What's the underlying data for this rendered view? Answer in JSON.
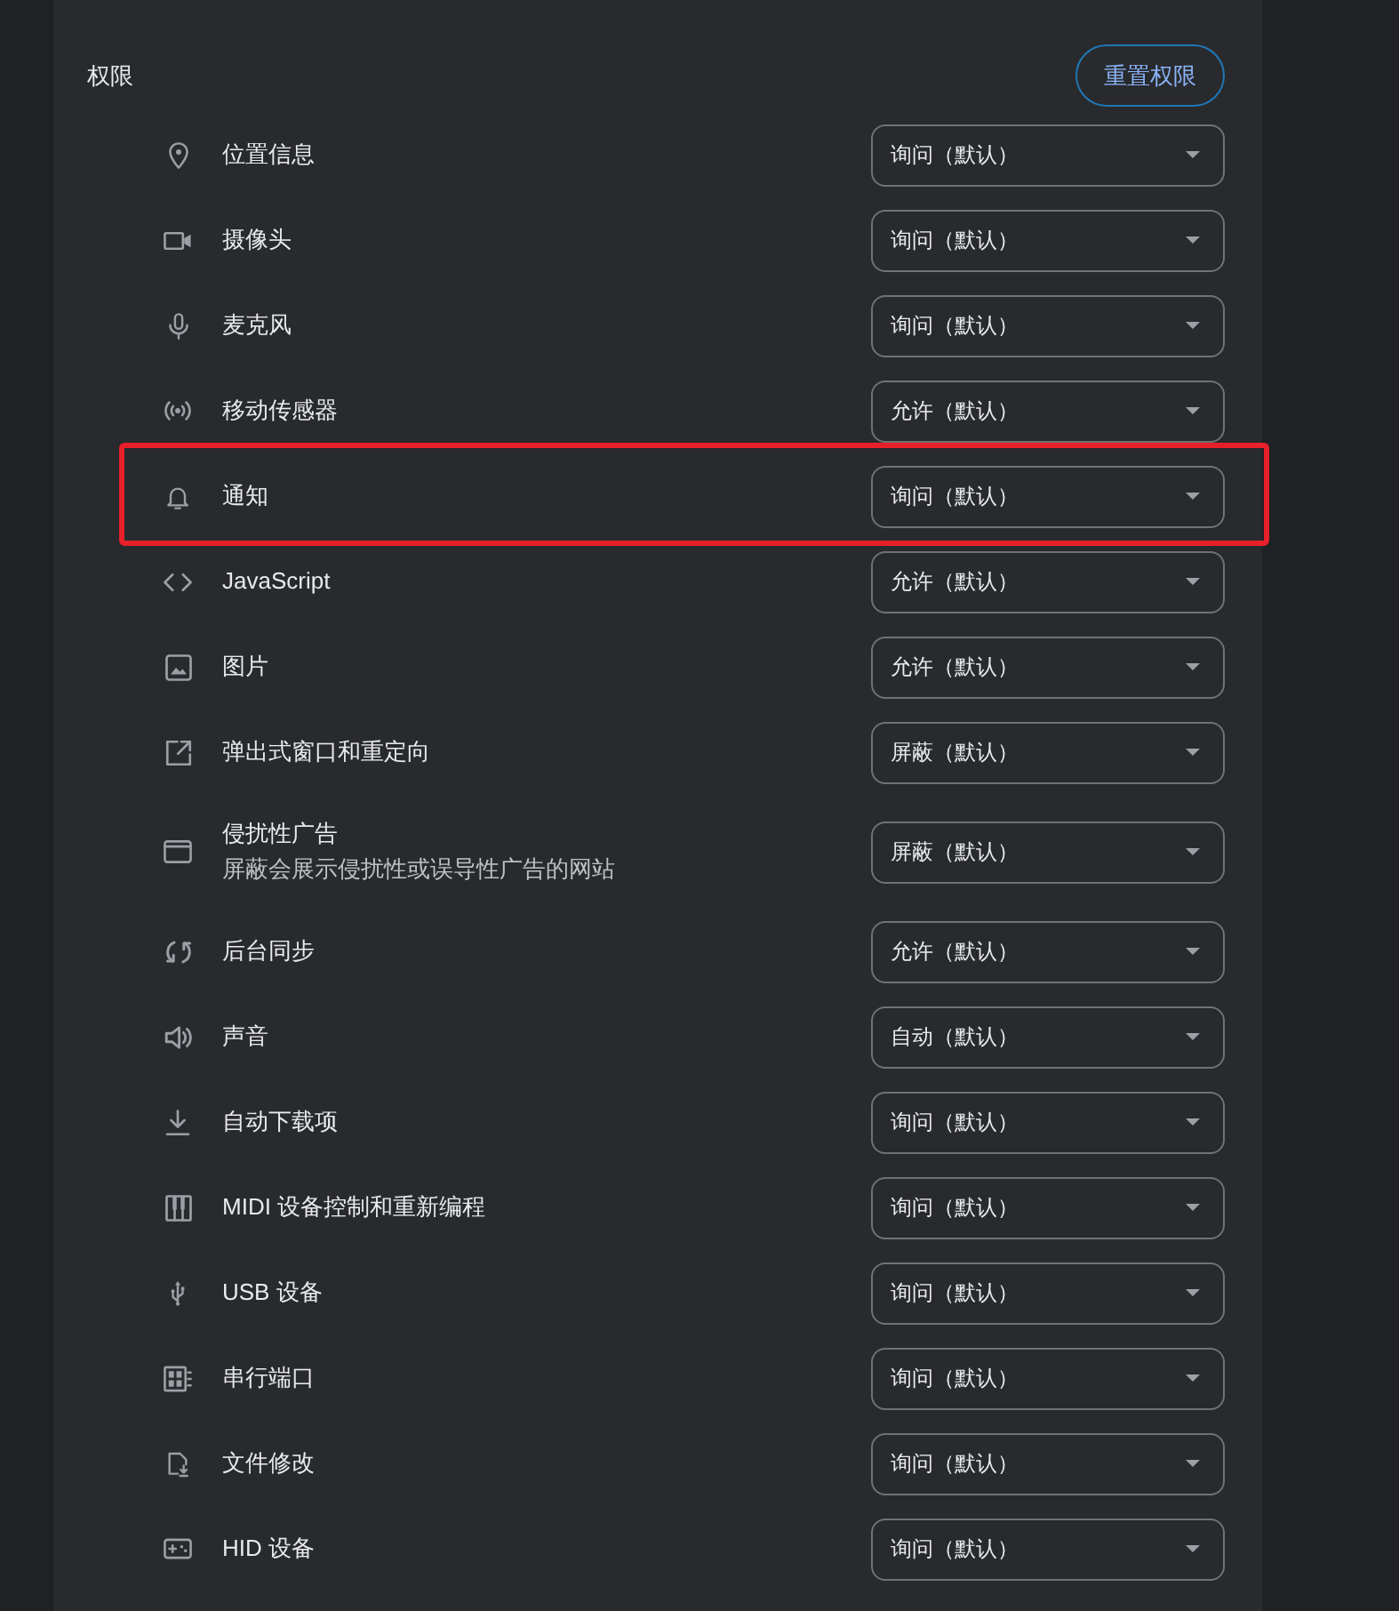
{
  "section": {
    "title": "权限",
    "reset_button": "重置权限"
  },
  "permissions": [
    {
      "kind": "location",
      "label": "位置信息",
      "value": "询问（默认）",
      "highlighted": false
    },
    {
      "kind": "camera",
      "label": "摄像头",
      "value": "询问（默认）",
      "highlighted": false
    },
    {
      "kind": "microphone",
      "label": "麦克风",
      "value": "询问（默认）",
      "highlighted": false
    },
    {
      "kind": "sensors",
      "label": "移动传感器",
      "value": "允许（默认）",
      "highlighted": false
    },
    {
      "kind": "notifications",
      "label": "通知",
      "value": "询问（默认）",
      "highlighted": true
    },
    {
      "kind": "javascript",
      "label": "JavaScript",
      "value": "允许（默认）",
      "highlighted": false
    },
    {
      "kind": "images",
      "label": "图片",
      "value": "允许（默认）",
      "highlighted": false
    },
    {
      "kind": "popups",
      "label": "弹出式窗口和重定向",
      "value": "屏蔽（默认）",
      "highlighted": false
    },
    {
      "kind": "ads",
      "label": "侵扰性广告",
      "description": "屏蔽会展示侵扰性或误导性广告的网站",
      "value": "屏蔽（默认）",
      "highlighted": false
    },
    {
      "kind": "sync",
      "label": "后台同步",
      "value": "允许（默认）",
      "highlighted": false
    },
    {
      "kind": "sound",
      "label": "声音",
      "value": "自动（默认）",
      "highlighted": false
    },
    {
      "kind": "download",
      "label": "自动下载项",
      "value": "询问（默认）",
      "highlighted": false
    },
    {
      "kind": "midi",
      "label": "MIDI 设备控制和重新编程",
      "value": "询问（默认）",
      "highlighted": false
    },
    {
      "kind": "usb",
      "label": "USB 设备",
      "value": "询问（默认）",
      "highlighted": false
    },
    {
      "kind": "serial",
      "label": "串行端口",
      "value": "询问（默认）",
      "highlighted": false
    },
    {
      "kind": "file",
      "label": "文件修改",
      "value": "询问（默认）",
      "highlighted": false
    },
    {
      "kind": "hid",
      "label": "HID 设备",
      "value": "询问（默认）",
      "highlighted": false
    }
  ]
}
